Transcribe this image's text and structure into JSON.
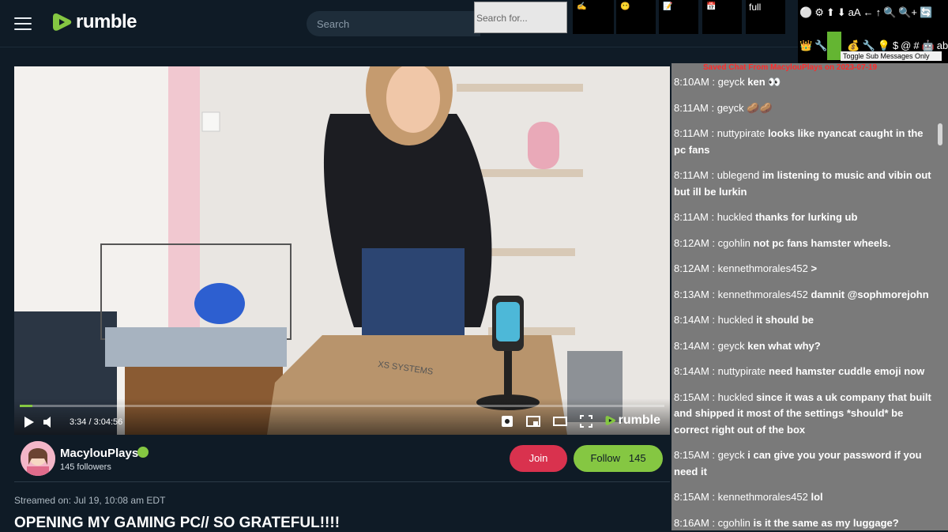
{
  "header": {
    "logo_text": "rumble",
    "search_placeholder": "Search",
    "brand_color": "#85c742"
  },
  "extension": {
    "search_placeholder": "Search for...",
    "box_full_label": "full",
    "icons": [
      "pointing-hand-icon",
      "face-icon",
      "note-icon",
      "calendar-icon"
    ],
    "tools_row1": [
      "⚪",
      "⚙",
      "⬆",
      "⬇",
      "aA",
      "←",
      "↑",
      "🔍",
      "🔍+",
      "🔄"
    ],
    "tools_row2": [
      "👑",
      "🔧",
      "💰",
      "🔧",
      "💡",
      "$",
      "@",
      "#",
      "🤖",
      "ab"
    ],
    "tooltip": "Toggle Sub Messages Only"
  },
  "player": {
    "time": "3:34 / 3:04:56",
    "progress": 0.0193,
    "logo_text": "rumble",
    "scene_label": "XS SYSTEMS"
  },
  "channel": {
    "name": "MacylouPlays",
    "followers": "145 followers",
    "join_label": "Join",
    "follow_label": "Follow",
    "follow_count": "145"
  },
  "video_meta": {
    "streamed": "Streamed on: Jul 19, 10:08 am EDT",
    "title": "OPENING MY GAMING PC// SO GRATEFUL!!!!"
  },
  "chat": {
    "header": "Saved Chat From MacylouPlays on 2023-07-19",
    "messages": [
      {
        "time": "8:10AM",
        "user": "geyck",
        "text": "ken 👀"
      },
      {
        "time": "8:11AM",
        "user": "geyck",
        "text": "🥔🥔"
      },
      {
        "time": "8:11AM",
        "user": "nuttypirate",
        "text": "looks like nyancat caught in the pc fans"
      },
      {
        "time": "8:11AM",
        "user": "ublegend",
        "text": "im listening to music and vibin out but ill be lurkin"
      },
      {
        "time": "8:11AM",
        "user": "huckled",
        "text": "thanks for lurking ub"
      },
      {
        "time": "8:12AM",
        "user": "cgohlin",
        "text": "not pc fans hamster wheels."
      },
      {
        "time": "8:12AM",
        "user": "kennethmorales452",
        "text": ">"
      },
      {
        "time": "8:13AM",
        "user": "kennethmorales452",
        "text": "damnit @sophmorejohn"
      },
      {
        "time": "8:14AM",
        "user": "huckled",
        "text": "it should be"
      },
      {
        "time": "8:14AM",
        "user": "geyck",
        "text": "ken what why?"
      },
      {
        "time": "8:14AM",
        "user": "nuttypirate",
        "text": "need hamster cuddle emoji now"
      },
      {
        "time": "8:15AM",
        "user": "huckled",
        "text": "since it was a uk company that built and shipped it most of the settings *should* be correct right out of the box"
      },
      {
        "time": "8:15AM",
        "user": "geyck",
        "text": "i can give you your password if you need it"
      },
      {
        "time": "8:15AM",
        "user": "kennethmorales452",
        "text": "lol"
      },
      {
        "time": "8:16AM",
        "user": "cgohlin",
        "text": "is it the same as my luggage?"
      }
    ]
  }
}
